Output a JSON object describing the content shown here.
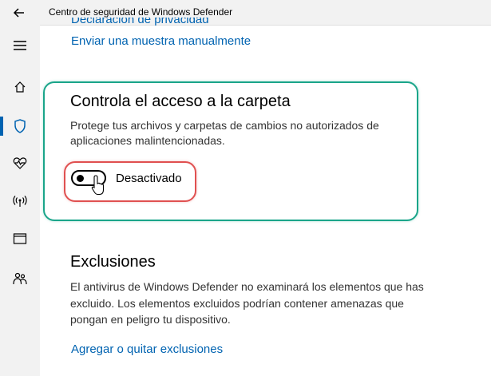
{
  "window": {
    "title": "Centro de seguridad de Windows Defender"
  },
  "links": {
    "privacy": "Declaración de privacidad",
    "send_sample": "Enviar una muestra manualmente",
    "exclusions_link": "Agregar o quitar exclusiones"
  },
  "folder_access": {
    "title": "Controla el acceso a la carpeta",
    "description_line1": "Protege tus archivos y carpetas de cambios no autorizados de",
    "description_line2": "aplicaciones malintencionadas.",
    "toggle_label": "Desactivado",
    "toggle_state": "off"
  },
  "exclusions": {
    "title": "Exclusiones",
    "line1": "El antivirus de Windows Defender no examinará los elementos que has",
    "line2": "excluido. Los elementos excluidos podrían contener amenazas que",
    "line3": "pongan en peligro tu dispositivo."
  },
  "sidebar": {
    "items": [
      {
        "icon": "menu-icon"
      },
      {
        "icon": "home-icon"
      },
      {
        "icon": "shield-icon",
        "active": true
      },
      {
        "icon": "heart-pulse-icon"
      },
      {
        "icon": "wireless-icon"
      },
      {
        "icon": "browser-window-icon"
      },
      {
        "icon": "family-icon"
      }
    ]
  },
  "colors": {
    "accent": "#0063b1",
    "teal_highlight": "#1aa58a",
    "red_highlight": "#e05050"
  }
}
